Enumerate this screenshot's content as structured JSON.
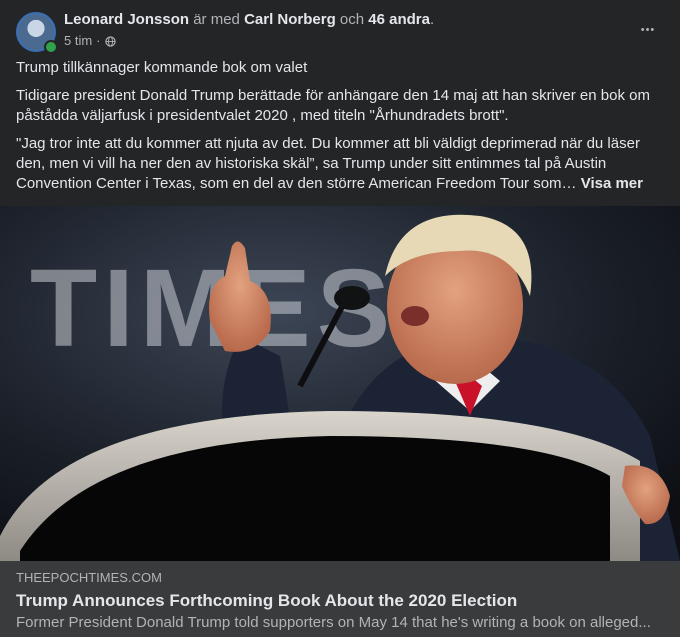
{
  "post": {
    "author": "Leonard Jonsson",
    "with_text": "är med",
    "tagged": "Carl Norberg",
    "and_text": "och",
    "others": "46 andra",
    "period": ".",
    "time": "5 tim",
    "dot": "·",
    "privacy_icon": "globe-icon",
    "more_label": "•••",
    "headline": "Trump tillkännager kommande bok om valet",
    "paragraph1": "Tidigare president Donald Trump berättade för anhängare den 14 maj att han skriver en bok om påstådda väljarfusk i presidentvalet 2020 , med titeln \"Århundradets brott\".",
    "paragraph2": "\"Jag tror inte att du kommer att njuta av det. Du kommer att bli väldigt deprimerad när du läser den, men vi vill ha ner den av historiska skäl”, sa Trump under sitt entimmes tal på Austin Convention Center i Texas, som en del av den större American Freedom Tour  som…",
    "see_more": "Visa mer"
  },
  "photo": {
    "backdrop_text": "TIMES O"
  },
  "link_card": {
    "domain": "THEEPOCHTIMES.COM",
    "title": "Trump Announces Forthcoming Book About the 2020 Election",
    "description": "Former President Donald Trump told supporters on May 14 that he's writing a book on alleged..."
  },
  "colors": {
    "background": "#242526",
    "card": "#3a3b3c",
    "text_primary": "#e4e6eb",
    "text_secondary": "#b0b3b8",
    "online": "#31a24c"
  }
}
